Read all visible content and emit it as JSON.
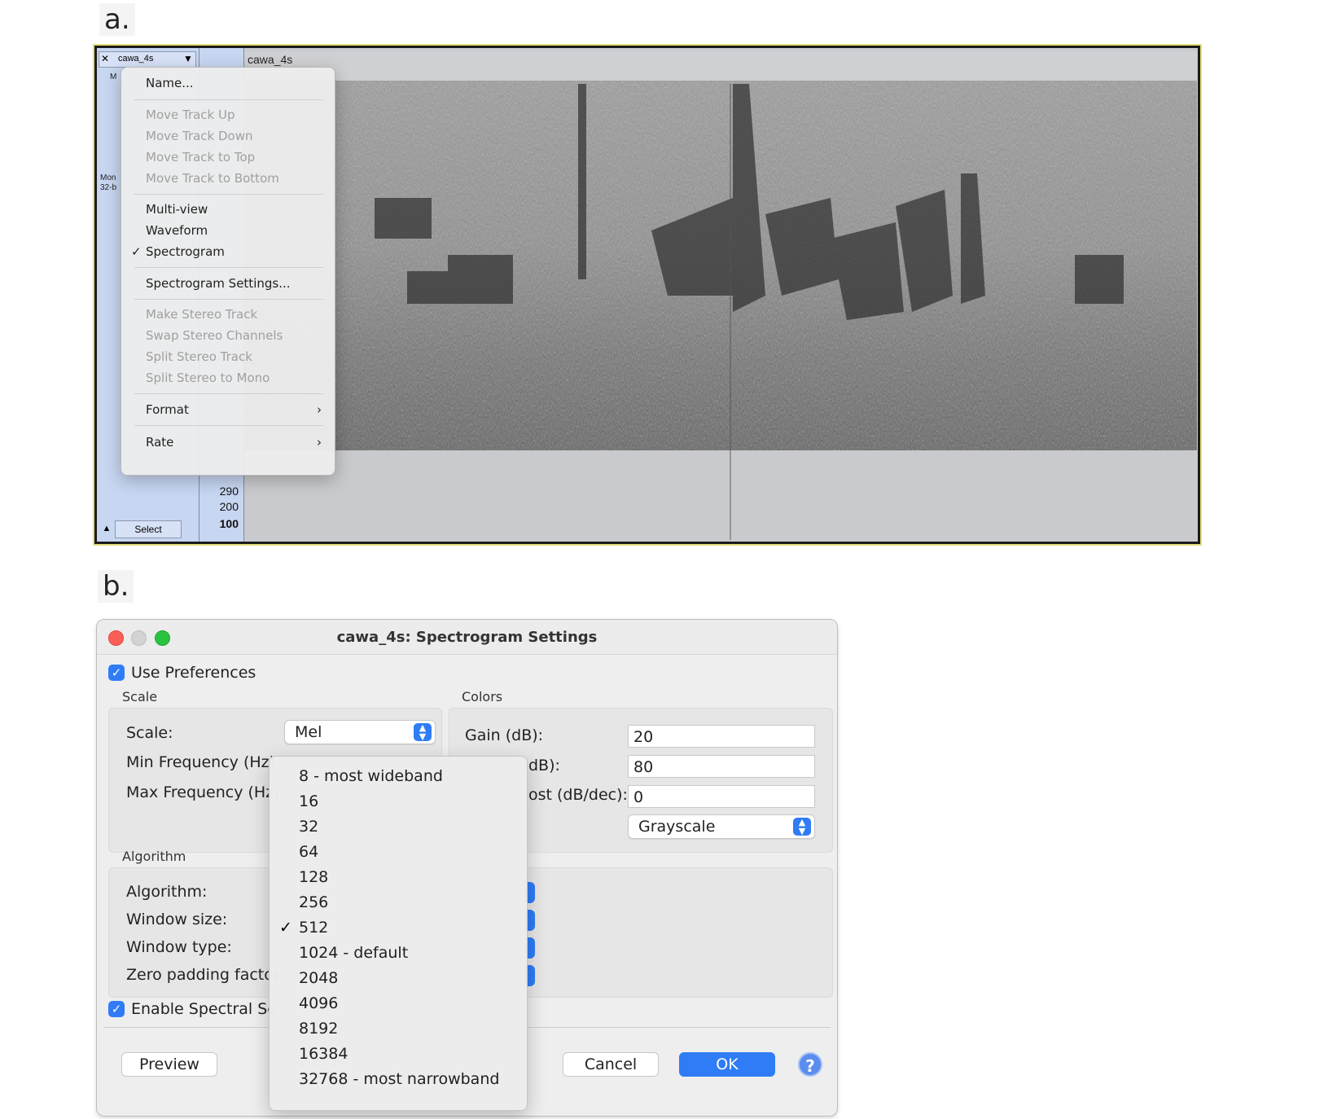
{
  "labels": {
    "panel_a": "a.",
    "panel_b": "b."
  },
  "track": {
    "name": "cawa_4s",
    "title": "cawa_4s",
    "mute_fragment": "M",
    "mono_fragment": "Mon",
    "bits_fragment": "32-b",
    "select_label": "Select"
  },
  "ruler": {
    "ticks": [
      "290",
      "200",
      "100"
    ]
  },
  "context_menu": {
    "name": "Name...",
    "move_up": "Move Track Up",
    "move_down": "Move Track Down",
    "move_top": "Move Track to Top",
    "move_bottom": "Move Track to Bottom",
    "multi_view": "Multi-view",
    "waveform": "Waveform",
    "spectrogram": "Spectrogram",
    "spectrogram_checked": true,
    "spectrogram_settings": "Spectrogram Settings...",
    "make_stereo": "Make Stereo Track",
    "swap_stereo": "Swap Stereo Channels",
    "split_stereo": "Split Stereo Track",
    "split_mono": "Split Stereo to Mono",
    "format": "Format",
    "rate": "Rate"
  },
  "dialog": {
    "title": "cawa_4s: Spectrogram Settings",
    "use_preferences": "Use Preferences",
    "use_preferences_checked": true,
    "scale_group": "Scale",
    "scale_label": "Scale:",
    "scale_value": "Mel",
    "min_freq_label": "Min Frequency (Hz)",
    "max_freq_label": "Max Frequency (Hz)",
    "colors_group": "Colors",
    "gain_label": "Gain (dB):",
    "gain_value": "20",
    "range_label_fragment": "dB):",
    "range_value": "80",
    "boost_label_fragment": "ost (dB/dec):",
    "boost_value": "0",
    "scheme_value": "Grayscale",
    "algorithm_group": "Algorithm",
    "algorithm_label": "Algorithm:",
    "window_size_label": "Window size:",
    "window_type_label": "Window type:",
    "zero_padding_label": "Zero padding factor",
    "enable_spectral_label": "Enable Spectral Se",
    "enable_spectral_checked": true,
    "preview_button": "Preview",
    "cancel_button": "Cancel",
    "ok_button": "OK",
    "help_button": "?"
  },
  "window_size_options": [
    "8 - most wideband",
    "16",
    "32",
    "64",
    "128",
    "256",
    "512",
    "1024 - default",
    "2048",
    "4096",
    "8192",
    "16384",
    "32768 - most narrowband"
  ],
  "window_size_selected": "512",
  "colors": {
    "accent": "#2f7cf6",
    "track_panel": "#c7d6f1",
    "spectrogram_bg": "#cfd0d3"
  }
}
